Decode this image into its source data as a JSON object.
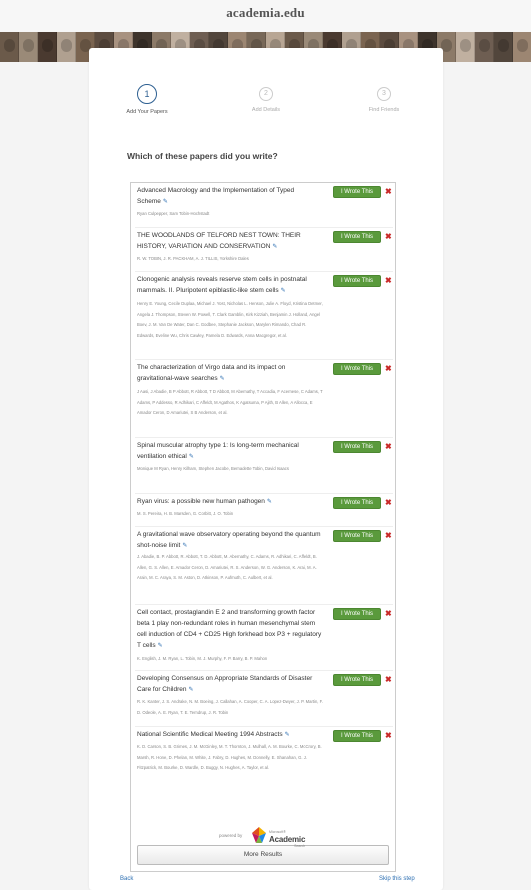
{
  "header": {
    "logo": "academia.edu"
  },
  "steps": [
    {
      "num": "1",
      "label": "Add Your Papers",
      "active": true
    },
    {
      "num": "2",
      "label": "Add Details",
      "active": false
    },
    {
      "num": "3",
      "label": "Find Friends",
      "active": false
    }
  ],
  "question": "Which of these papers did you write?",
  "action": {
    "wrote": "I Wrote This",
    "reject": "✖"
  },
  "papers": [
    {
      "title": "Advanced Macrology and the Implementation of Typed Scheme",
      "authors": "Ryan Culpepper, Sam Tobin-Hochstadt"
    },
    {
      "title": "THE WOODLANDS OF TELFORD NEST TOWN: THEIR HISTORY, VARIATION AND CONSERVATION",
      "authors": "R. W. TOBIN, J. R. PACKHAM, A. J. TILLIS, Yorkshire Dales"
    },
    {
      "title": "Clonogenic analysis reveals reserve stem cells in postnatal mammals. II. Pluripotent epiblastic-like stem cells",
      "authors": "Henry E. Young, Cecile Duplaa, Michael J. Yost, Nicholas L. Henson, Julie A. Floyd, Kristina Detmer, Angela J. Thompson, Steven W. Powell, T. Clark Gamblin, Kirk Kizziah, Benjamin J. Holland, Angel Boev, J. M. Van De Water, Dan C. Godbee, Stephanie Jackson, Marylen Rimando, Chad R. Edwards, Eveline Wu, Chris Cawley, Pamela D. Edwards, Anna Macgregor, et al."
    },
    {
      "title": "The characterization of Virgo data and its impact on gravitational-wave searches",
      "authors": "J Aasi, J Abadie, B P Abbott, R Abbott, T D Abbott, M Abernathy, T Accadia, F Acernese, C Adams, T Adams, P Addesso, R Adhikari, C Affeldt, M Agathos, K Agatsuma, P Ajith, B Allen, A Allocca, E Amador Ceron, D Amariutei, S B Anderson, et al."
    },
    {
      "title": "Spinal muscular atrophy type 1: Is long-term mechanical ventilation ethical",
      "authors": "Monique M Ryan, Henry Kilham, Stephen Jacobe, Bernadette Tobin, David Isaacs"
    },
    {
      "title": "Ryan virus: a possible new human pathogen",
      "authors": "M. S. Pereira, H. B. Marsden, G. Corbitt, J. O. Tobin"
    },
    {
      "title": "A gravitational wave observatory operating beyond the quantum shot-noise limit",
      "authors": "J. Abadie, B. P. Abbott, R. Abbott, T. D. Abbott, M. Abernathy, C. Adams, R. Adhikari, C. Affeldt, B. Allen, G. S. Allen, E. Amador Ceron, D. Amariutei, R. S. Anderson, W. G. Anderson, K. Arai, M. A. Arain, M. C. Araya, S. M. Aston, D. Atkinson, P. Aufmuth, C. Aulbert, et al."
    },
    {
      "title": "Cell contact, prostaglandin E 2 and transforming growth factor beta 1 play non-redundant roles in human mesenchymal stem cell induction of CD4 + CD25 High forkhead box P3 + regulatory T cells",
      "authors": "K. English, J. M. Ryan, L. Tobin, M. J. Murphy, F. P. Barry, B. P. Mahon"
    },
    {
      "title": "Developing Consensus on Appropriate Standards of Disaster Care for Children",
      "authors": "R. K. Kanter, J. S. Andrake, N. M. Boeing, J. Callahan, A. Cooper, C. A. Lopez-Dwyer, J. P. Martin, F. D. Odeole, A. E. Ryan, T. E. Terndrup, J. R. Tobin"
    },
    {
      "title": "National Scientific Medical Meeting 1994 Abstracts",
      "authors": "K. D. Carson, S. B. Grimes, J. M. McGinley, M. T. Thornton, J. Mulhall, A. M. Bourke, C. McCrory, B. Marsh, R. Hone, D. Phelan, M. White, J. Fabry, D. Hughes, M. Donnelly, E. Shanahan, G. J. Fitzpatrick, M. Bourke, D. Wardle, D. Buggy, N. Hughes, A. Taylor, et al."
    }
  ],
  "more_results": "More Results",
  "powered_by": "powered by",
  "ms_brand": {
    "line1": "Microsoft®",
    "name": "Academic",
    "line3": "Search"
  },
  "footer": {
    "back": "Back",
    "skip": "Skip this step"
  },
  "colors": {
    "accent": "#2d5f91",
    "wrote_button": "#5a9a3c",
    "reject": "#c92a2a",
    "link": "#2d6fb2"
  }
}
